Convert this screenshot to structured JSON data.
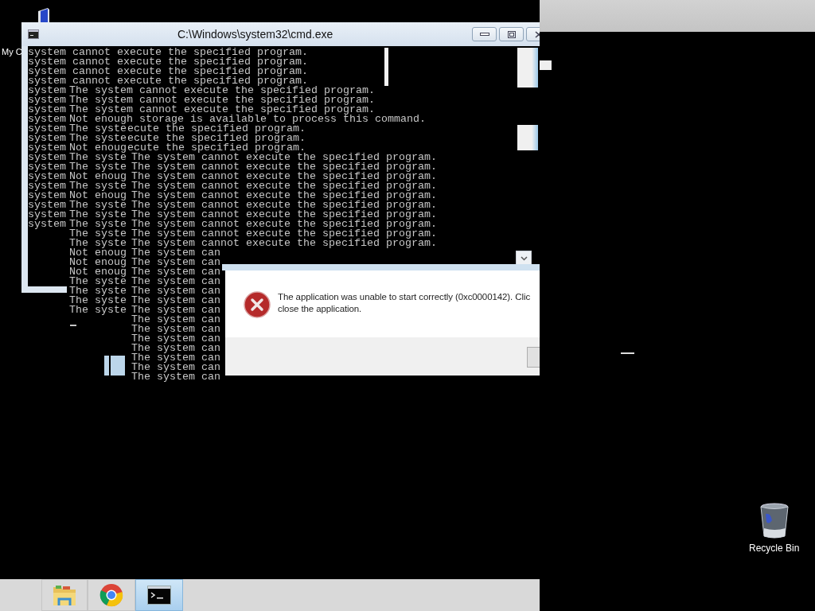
{
  "desktop_icons": [
    {
      "kind": "computer",
      "label": "My C"
    },
    {
      "kind": "recycle_bin",
      "label": "Recycle Bin"
    }
  ],
  "cmd_window": {
    "title": "C:\\Windows\\system32\\cmd.exe",
    "lines": [
      "system cannot execute the specified program.",
      "system cannot execute the specified program.",
      "system cannot execute the specified program.",
      "system cannot execute the specified program.",
      "system",
      "system",
      "system",
      "system",
      "system",
      "system",
      "system",
      "system",
      "system",
      "system",
      "system",
      "system",
      "system",
      "system",
      "system"
    ]
  },
  "console_layers": [
    {
      "lines": [
        "The system cannot execute the specified program.",
        "The system cannot execute the specified program.",
        "The system cannot execute the specified program.",
        "Not enough storage is available to process this command.",
        "The syste",
        "The syste",
        "Not enoug",
        "The syste",
        "The syste",
        "Not enoug",
        "The syste",
        "Not enoug",
        "The syste",
        "The syste",
        "The syste",
        "The syste",
        "The syste",
        "Not enoug",
        "Not enoug",
        "Not enoug",
        "The syste",
        "The syste",
        "The syste",
        "The syste"
      ]
    },
    {
      "lines": [
        "ecute the specified program.",
        "ecute the specified program.",
        "ecute the specified program."
      ]
    },
    {
      "lines": [
        "The system cannot execute the specified program.",
        "The system cannot execute the specified program.",
        "The system cannot execute the specified program.",
        "The system cannot execute the specified program.",
        "The system cannot execute the specified program.",
        "The system cannot execute the specified program.",
        "The system cannot execute the specified program.",
        "The system cannot execute the specified program.",
        "The system cannot execute the specified program.",
        "The system cannot execute the specified program.",
        "The system can",
        "The system can",
        "The system can",
        "The system can",
        "The system can",
        "The system can",
        "The system can",
        "The system can",
        "The system can",
        "The system can",
        "The system can",
        "The system can",
        "The system can",
        "The system can"
      ]
    }
  ],
  "dialog": {
    "message_lines": [
      "The application was unable to start correctly (0xc0000142). Clic",
      "close the application."
    ]
  },
  "taskbar": {
    "items": [
      {
        "kind": "folder",
        "selected": false
      },
      {
        "kind": "browser",
        "selected": false
      },
      {
        "kind": "terminal",
        "selected": true
      }
    ]
  }
}
